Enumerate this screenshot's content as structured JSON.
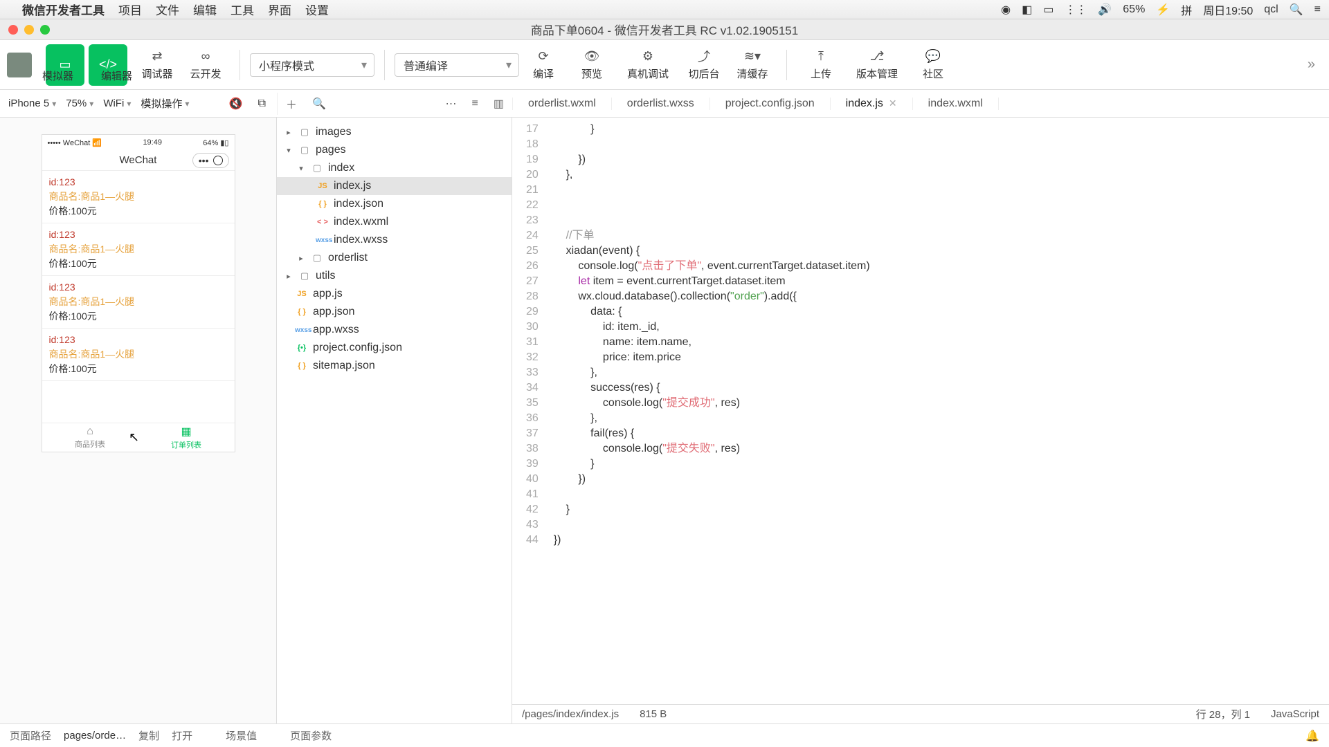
{
  "menubar": {
    "appname": "微信开发者工具",
    "items": [
      "项目",
      "文件",
      "编辑",
      "工具",
      "界面",
      "设置"
    ],
    "battery": "65%",
    "date": "周日19:50",
    "user": "qcl"
  },
  "window": {
    "title": "商品下单0604 - 微信开发者工具 RC v1.02.1905151"
  },
  "toolbar": {
    "sim": "模拟器",
    "editor": "编辑器",
    "debugger": "调试器",
    "cloud": "云开发",
    "mode": "小程序模式",
    "compileMode": "普通编译",
    "compile": "编译",
    "preview": "预览",
    "remote": "真机调试",
    "background": "切后台",
    "clearCache": "清缓存",
    "upload": "上传",
    "version": "版本管理",
    "community": "社区"
  },
  "secondbar": {
    "device": "iPhone 5",
    "zoom": "75%",
    "network": "WiFi",
    "simops": "模拟操作"
  },
  "editorTabs": [
    {
      "label": "orderlist.wxml",
      "active": false
    },
    {
      "label": "orderlist.wxss",
      "active": false
    },
    {
      "label": "project.config.json",
      "active": false
    },
    {
      "label": "index.js",
      "active": true
    },
    {
      "label": "index.wxml",
      "active": false
    }
  ],
  "tree": {
    "images": "images",
    "pages": "pages",
    "index": "index",
    "index_js": "index.js",
    "index_json": "index.json",
    "index_wxml": "index.wxml",
    "index_wxss": "index.wxss",
    "orderlist": "orderlist",
    "utils": "utils",
    "app_js": "app.js",
    "app_json": "app.json",
    "app_wxss": "app.wxss",
    "project_config": "project.config.json",
    "sitemap": "sitemap.json"
  },
  "simulator": {
    "carrier": "••••• WeChat",
    "time": "19:49",
    "battery": "64%",
    "navTitle": "WeChat",
    "items": [
      {
        "id": "id:123",
        "name": "商品名:商品1—火腿",
        "price": "价格:100元"
      },
      {
        "id": "id:123",
        "name": "商品名:商品1—火腿",
        "price": "价格:100元"
      },
      {
        "id": "id:123",
        "name": "商品名:商品1—火腿",
        "price": "价格:100元"
      },
      {
        "id": "id:123",
        "name": "商品名:商品1—火腿",
        "price": "价格:100元"
      }
    ],
    "tab1": "商品列表",
    "tab2": "订单列表"
  },
  "code": {
    "startLine": 17,
    "lines": [
      "            }",
      "",
      "        })",
      "    },",
      "",
      "",
      "",
      "    //下单",
      "    xiadan(event) {",
      "        console.log(\"点击了下单\", event.currentTarget.dataset.item)",
      "        let item = event.currentTarget.dataset.item",
      "        wx.cloud.database().collection(\"order\").add({",
      "            data: {",
      "                id: item._id,",
      "                name: item.name,",
      "                price: item.price",
      "            },",
      "            success(res) {",
      "                console.log(\"提交成功\", res)",
      "            },",
      "            fail(res) {",
      "                console.log(\"提交失败\", res)",
      "            }",
      "        })",
      "",
      "    }",
      "",
      "})"
    ]
  },
  "codestatus": {
    "path": "/pages/index/index.js",
    "size": "815 B",
    "pos": "行 28，列 1",
    "lang": "JavaScript"
  },
  "bottombar": {
    "label": "页面路径",
    "path": "pages/orde…",
    "copy": "复制",
    "open": "打开",
    "scene": "场景值",
    "params": "页面参数"
  }
}
